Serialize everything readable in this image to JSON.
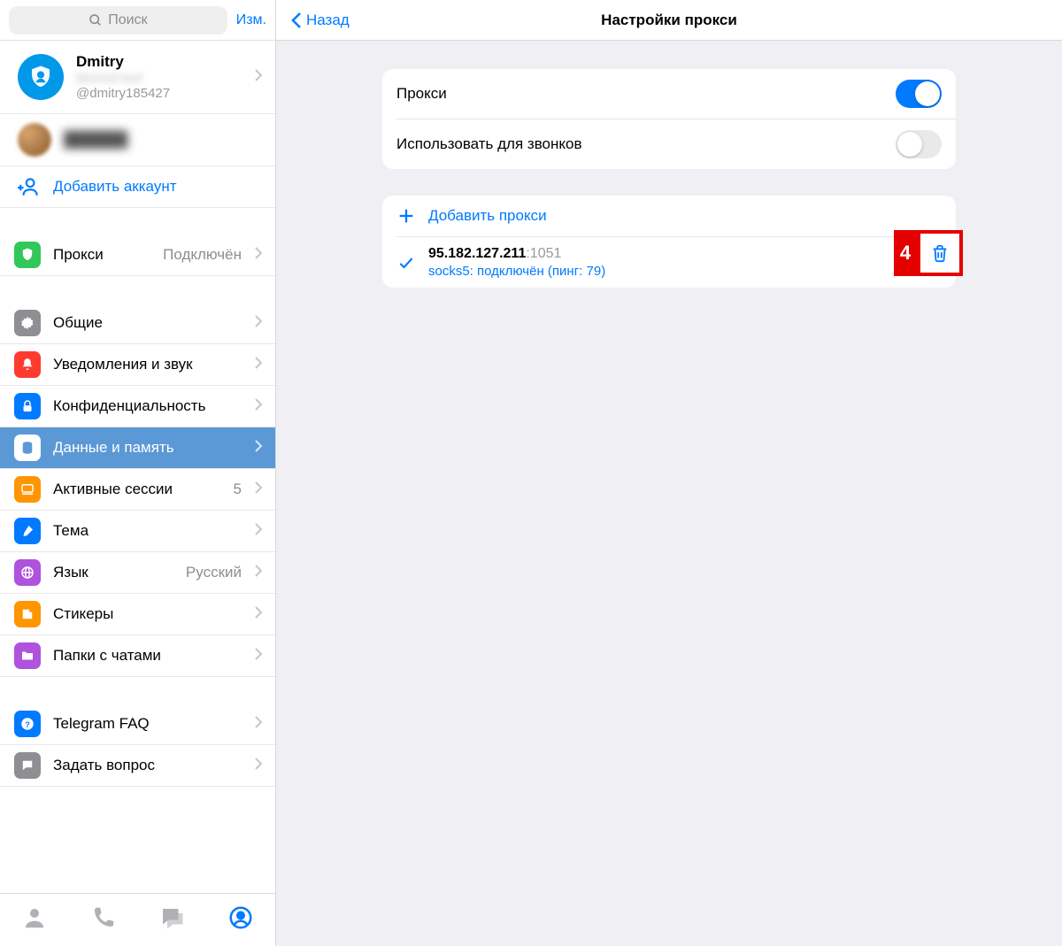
{
  "sidebar": {
    "search_placeholder": "Поиск",
    "edit_label": "Изм.",
    "profile": {
      "name": "Dmitry",
      "line1_blurred": "blurred text",
      "username": "@dmitry185427"
    },
    "add_account_label": "Добавить аккаунт",
    "rows": {
      "proxy": {
        "label": "Прокси",
        "value": "Подключён"
      },
      "general": {
        "label": "Общие"
      },
      "notifications": {
        "label": "Уведомления и звук"
      },
      "privacy": {
        "label": "Конфиденциальность"
      },
      "data": {
        "label": "Данные и память"
      },
      "sessions": {
        "label": "Активные сессии",
        "value": "5"
      },
      "theme": {
        "label": "Тема"
      },
      "language": {
        "label": "Язык",
        "value": "Русский"
      },
      "stickers": {
        "label": "Стикеры"
      },
      "folders": {
        "label": "Папки с чатами"
      },
      "faq": {
        "label": "Telegram FAQ"
      },
      "ask": {
        "label": "Задать вопрос"
      }
    }
  },
  "main": {
    "back_label": "Назад",
    "title": "Настройки прокси",
    "toggles": {
      "proxy_label": "Прокси",
      "calls_label": "Использовать для звонков"
    },
    "add_proxy_label": "Добавить прокси",
    "proxy_entry": {
      "ip": "95.182.127.211",
      "port": ":1051",
      "status": "socks5: подключён (пинг: 79)"
    },
    "annotation_number": "4"
  }
}
